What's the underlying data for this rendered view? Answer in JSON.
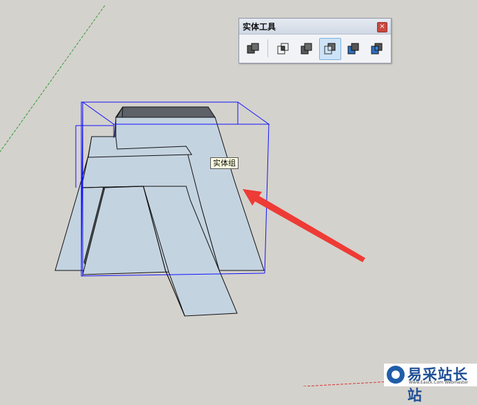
{
  "toolbar": {
    "title": "实体工具",
    "close_glyph": "×",
    "buttons": [
      {
        "name": "outer-shell-button",
        "icon": "outer-shell-icon",
        "active": false
      },
      {
        "name": "intersect-button",
        "icon": "intersect-icon",
        "active": false
      },
      {
        "name": "union-button",
        "icon": "union-icon",
        "active": false
      },
      {
        "name": "subtract-button",
        "icon": "subtract-icon",
        "active": true
      },
      {
        "name": "trim-button",
        "icon": "trim-icon",
        "active": false
      },
      {
        "name": "split-button",
        "icon": "split-icon",
        "active": false
      }
    ]
  },
  "viewport": {
    "tooltip": "实体组",
    "colors": {
      "background": "#d4d2cd",
      "face": "#c4d3e0",
      "dark_face": "#5a5f66",
      "bounding_box": "#1111ff",
      "axis_green": "#2f9e3a",
      "arrow": "#ee3b35"
    }
  },
  "watermark": {
    "text": "易采站长站",
    "subtext": "Www.Easck.Com Webmaster"
  }
}
